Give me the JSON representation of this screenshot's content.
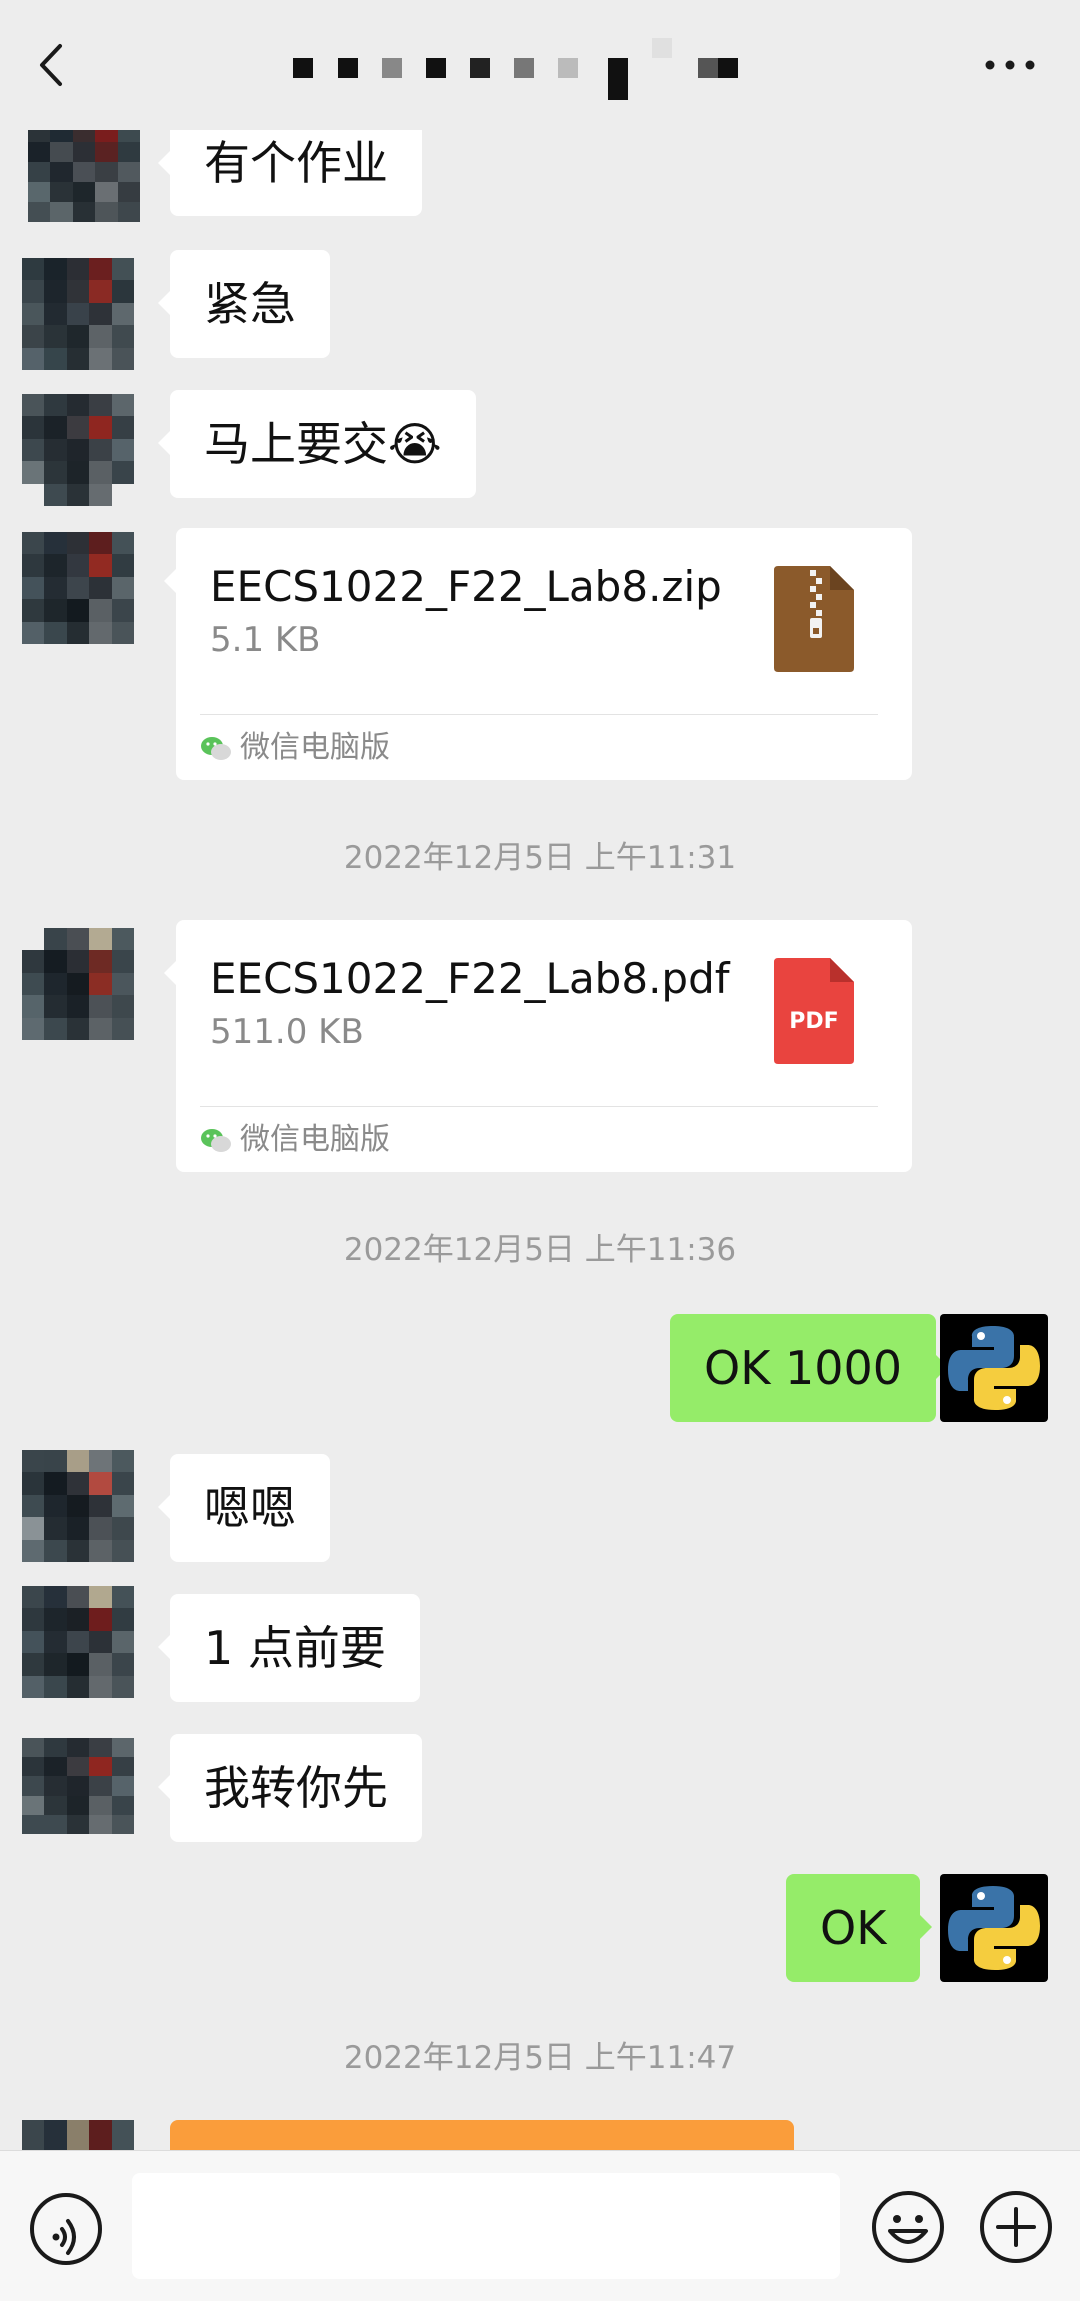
{
  "header": {
    "back_icon": "chevron-left-icon",
    "title_obscured": true,
    "more_icon": "more-dots-icon"
  },
  "messages": [
    {
      "type": "text",
      "text": "有个作业"
    },
    {
      "type": "text",
      "text": "紧急"
    },
    {
      "type": "text",
      "text": "马上要交😭"
    },
    {
      "type": "file",
      "name": "EECS1022_F22_Lab8.zip",
      "size": "5.1 KB",
      "source": "微信电脑版",
      "icon": "zip-file-icon"
    },
    {
      "type": "file",
      "name": "EECS1022_F22_Lab8.pdf",
      "size": "511.0 KB",
      "source": "微信电脑版",
      "icon": "pdf-file-icon",
      "icon_label": "PDF"
    },
    {
      "type": "text",
      "text": "OK 1000"
    },
    {
      "type": "text",
      "text": "嗯嗯"
    },
    {
      "type": "text",
      "text": "1 点前要"
    },
    {
      "type": "text",
      "text": "我转你先"
    },
    {
      "type": "text",
      "text": "OK"
    }
  ],
  "timestamps": [
    "2022年12月5日 上午11:31",
    "2022年12月5日 上午11:36",
    "2022年12月5日 上午11:47"
  ],
  "composer": {
    "voice_icon": "voice-icon",
    "input_value": "",
    "emoji_icon": "emoji-icon",
    "plus_icon": "plus-icon"
  },
  "colors": {
    "background": "#ededed",
    "incoming_bubble": "#ffffff",
    "outgoing_bubble": "#95ec69",
    "pdf_red": "#e9443f",
    "zip_brown": "#8b5a2b",
    "transfer_orange": "#fa9d3b"
  }
}
